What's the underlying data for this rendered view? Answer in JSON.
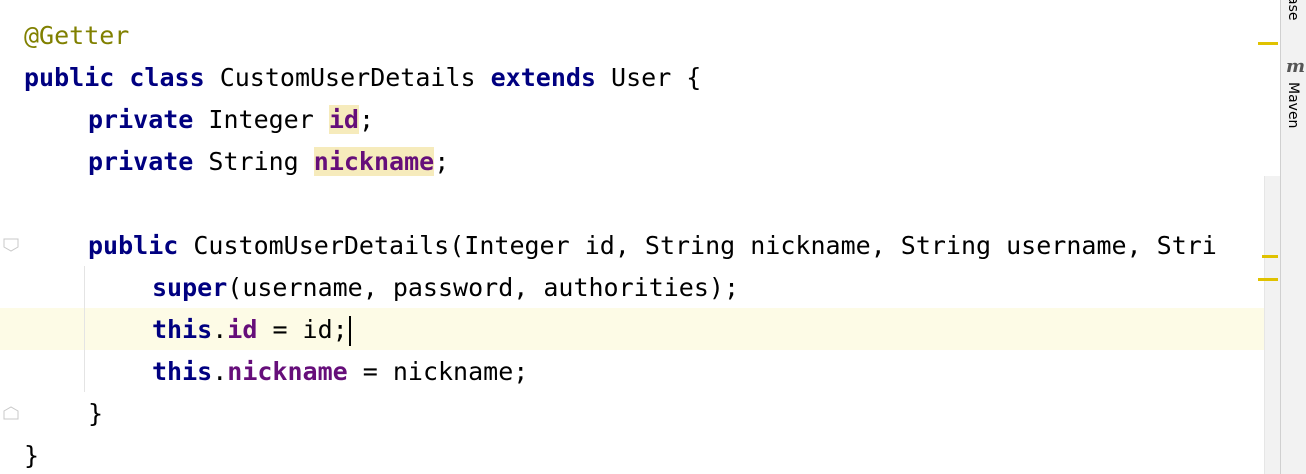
{
  "editor": {
    "lines": {
      "l1": {
        "annotation": "@Getter"
      },
      "l2": {
        "kw1": "public",
        "kw2": "class",
        "class_name": " CustomUserDetails ",
        "kw3": "extends",
        "rest": " User {"
      },
      "l3": {
        "kw": "private",
        "type": " Integer ",
        "field": "id",
        "end": ";"
      },
      "l4": {
        "kw": "private",
        "type": " String ",
        "field": "nickname",
        "end": ";"
      },
      "l6": {
        "kw": "public",
        "rest": " CustomUserDetails(Integer id, String nickname, String username, Stri"
      },
      "l7": {
        "kw": "super",
        "rest": "(username, password, authorities);"
      },
      "l8": {
        "kw": "this",
        "dot": ".",
        "field": "id",
        "rest": " = id;"
      },
      "l9": {
        "kw": "this",
        "dot": ".",
        "field": "nickname",
        "rest": " = nickname;"
      },
      "l10": {
        "text": "}"
      },
      "l11": {
        "text": "}"
      }
    }
  },
  "side_panel": {
    "database_label": "ase",
    "maven_icon": "m",
    "maven_label": "Maven"
  },
  "colors": {
    "keyword": "#000080",
    "annotation": "#808000",
    "field": "#660e7a",
    "usage_highlight": "#f6ebbc",
    "caret_row": "#fdfbe6",
    "marker": "#e0c200"
  }
}
